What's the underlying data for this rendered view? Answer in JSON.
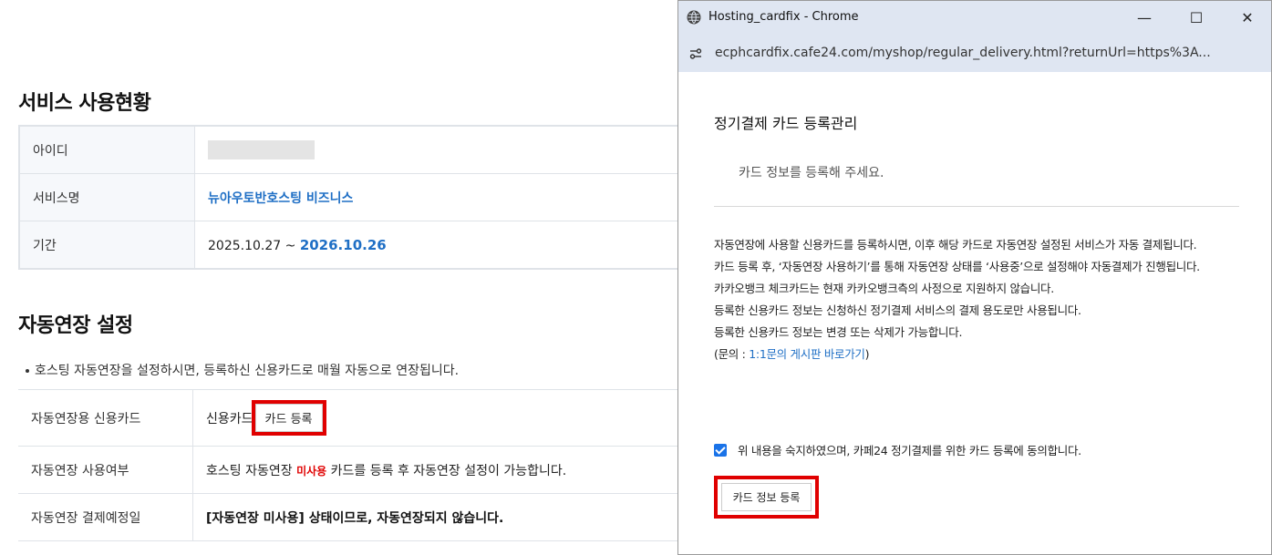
{
  "left": {
    "section1_title": "서비스 사용현황",
    "rows": [
      {
        "label": "아이디",
        "value": ""
      },
      {
        "label": "서비스명",
        "value": "뉴아우토반호스팅 비즈니스"
      },
      {
        "label": "기간",
        "start": "2025.10.27",
        "separator": " ~ ",
        "end": "2026.10.26"
      }
    ],
    "section2_title": "자동연장 설정",
    "notice": "호스팅 자동연장을 설정하시면, 등록하신 신용카드로 매월 자동으로 연장됩니다.",
    "auto_rows": {
      "card_label": "자동연장용 신용카드",
      "card_text": "신용카드",
      "card_button": "카드 등록",
      "use_label": "자동연장 사용여부",
      "use_prefix": "호스팅 자동연장",
      "use_status": "미사용",
      "use_suffix": " 카드를 등록 후 자동연장 설정이 가능합니다.",
      "date_label": "자동연장 결제예정일",
      "date_value": "[자동연장 미사용] 상태이므로, 자동연장되지 않습니다."
    }
  },
  "popup": {
    "window_title": "Hosting_cardfix - Chrome",
    "controls": {
      "minimize": "—",
      "maximize": "☐",
      "close": "✕"
    },
    "url": "ecphcardfix.cafe24.com/myshop/regular_delivery.html?returnUrl=https%3A...",
    "title": "정기결제 카드 등록관리",
    "subtitle": "카드 정보를 등록해 주세요.",
    "notices": [
      "자동연장에 사용할 신용카드를 등록하시면, 이후 해당 카드로 자동연장 설정된 서비스가 자동 결제됩니다.",
      "카드 등록 후, ‘자동연장 사용하기’를 통해 자동연장 상태를 ‘사용중’으로 설정해야 자동결제가 진행됩니다.",
      "카카오뱅크 체크카드는 현재 카카오뱅크측의 사정으로 지원하지 않습니다.",
      "등록한 신용카드 정보는 신청하신 정기결제 서비스의 결제 용도로만 사용됩니다.",
      "등록한 신용카드 정보는 변경 또는 삭제가 가능합니다."
    ],
    "inquiry_prefix": "(문의 : ",
    "inquiry_link": "1:1문의 게시판 바로가기",
    "inquiry_suffix": ")",
    "agree_text": "위 내용을 숙지하였으며, 카페24 정기결제를 위한 카드 등록에 동의합니다.",
    "submit_button": "카드 정보 등록"
  },
  "colors": {
    "accent_blue": "#1f6fc5",
    "highlight_red": "#e00000",
    "chrome_frame": "#dfe6f2"
  }
}
